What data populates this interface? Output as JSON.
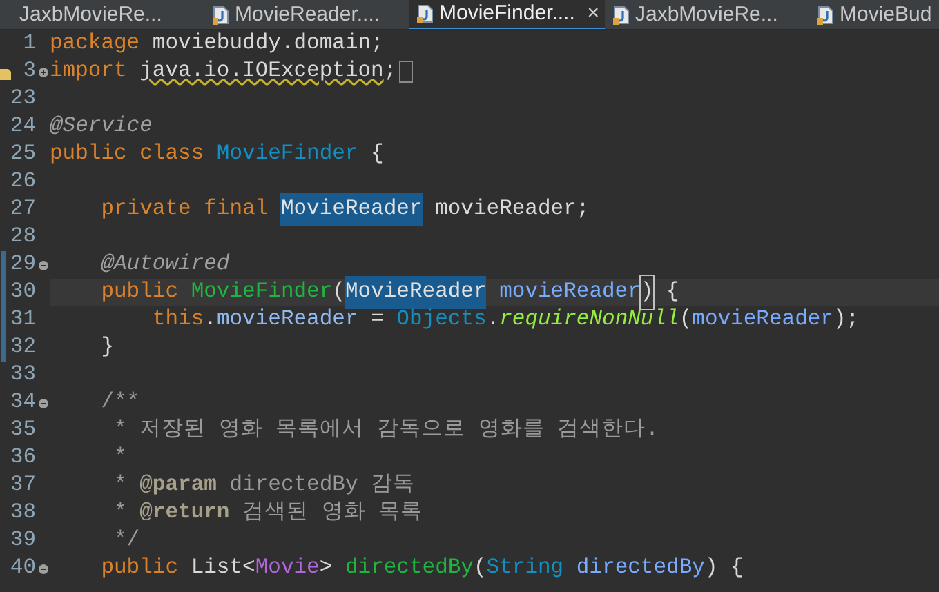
{
  "tabs": [
    {
      "label": "JaxbMovieRe...",
      "selected": false,
      "icon": false
    },
    {
      "label": "MovieReader....",
      "selected": false,
      "icon": true
    },
    {
      "label": "MovieFinder....",
      "selected": true,
      "icon": true,
      "close": "×"
    },
    {
      "label": "JaxbMovieRe...",
      "selected": false,
      "icon": true
    },
    {
      "label": "MovieBud",
      "selected": false,
      "icon": true
    }
  ],
  "lines": [
    {
      "number": "1",
      "current": false,
      "changed": false,
      "tokens": [
        {
          "kind": "keyword",
          "text": "package"
        },
        {
          "kind": "plain",
          "text": " moviebuddy.domain;"
        }
      ]
    },
    {
      "number": "3",
      "expanded": false,
      "warning": true,
      "current": false,
      "changed": false,
      "tokens": [
        {
          "kind": "keyword",
          "text": "import "
        },
        {
          "kind": "warned",
          "text": "java.io.IOException"
        },
        {
          "kind": "plain",
          "text": ";"
        }
      ]
    },
    {
      "number": "23",
      "current": false,
      "changed": false
    },
    {
      "number": "24",
      "current": false,
      "changed": false,
      "tokens": [
        {
          "kind": "annotation",
          "text": "@Service"
        }
      ]
    },
    {
      "number": "25",
      "current": false,
      "changed": false,
      "tokens": [
        {
          "kind": "keyword",
          "text": "public class "
        },
        {
          "kind": "type",
          "text": "MovieFinder"
        },
        {
          "kind": "plain",
          "text": " {"
        }
      ]
    },
    {
      "number": "26",
      "current": false,
      "changed": false
    },
    {
      "number": "27",
      "current": false,
      "changed": false,
      "tokens": [
        {
          "kind": "keyword",
          "text": "    private final "
        },
        {
          "kind": "occurrence",
          "text": "MovieReader"
        },
        {
          "kind": "plain",
          "text": " movieReader;"
        }
      ]
    },
    {
      "number": "28",
      "current": false,
      "changed": false
    },
    {
      "number": "29",
      "expanded": true,
      "current": false,
      "changed": true,
      "tokens": [
        {
          "kind": "annotation",
          "text": "    @Autowired"
        }
      ]
    },
    {
      "number": "30",
      "current": true,
      "changed": true,
      "tokens": [
        {
          "kind": "keyword",
          "text": "    public "
        },
        {
          "kind": "method",
          "text": "MovieFinder"
        },
        {
          "kind": "plain",
          "text": "("
        },
        {
          "kind": "occurrence",
          "text": "MovieReader"
        },
        {
          "kind": "param",
          "text": " movieReader"
        },
        {
          "kind": "bracket",
          "text": ")"
        },
        {
          "kind": "plain",
          "text": " {"
        }
      ]
    },
    {
      "number": "31",
      "current": false,
      "changed": true,
      "tokens": [
        {
          "kind": "keyword",
          "text": "        this"
        },
        {
          "kind": "plain",
          "text": "."
        },
        {
          "kind": "field",
          "text": "movieReader"
        },
        {
          "kind": "plain",
          "text": " = "
        },
        {
          "kind": "type",
          "text": "Objects"
        },
        {
          "kind": "plain",
          "text": "."
        },
        {
          "kind": "static",
          "text": "requireNonNull"
        },
        {
          "kind": "plain",
          "text": "("
        },
        {
          "kind": "param",
          "text": "movieReader"
        },
        {
          "kind": "plain",
          "text": ");"
        }
      ]
    },
    {
      "number": "32",
      "current": false,
      "changed": true,
      "tokens": [
        {
          "kind": "plain",
          "text": "    }"
        }
      ]
    },
    {
      "number": "33",
      "current": false,
      "changed": false
    },
    {
      "number": "34",
      "expanded": true,
      "current": false,
      "changed": false,
      "tokens": [
        {
          "kind": "comment",
          "text": "    /**"
        }
      ]
    },
    {
      "number": "35",
      "current": false,
      "changed": false,
      "tokens": [
        {
          "kind": "comment",
          "text": "     * 저장된 영화 목록에서 감독으로 영화를 검색한다."
        }
      ]
    },
    {
      "number": "36",
      "current": false,
      "changed": false,
      "tokens": [
        {
          "kind": "comment",
          "text": "     *"
        }
      ]
    },
    {
      "number": "37",
      "current": false,
      "changed": false,
      "tokens": [
        {
          "kind": "comment",
          "text": "     * "
        },
        {
          "kind": "tag",
          "text": "@param"
        },
        {
          "kind": "comment",
          "text": " directedBy 감독"
        }
      ]
    },
    {
      "number": "38",
      "current": false,
      "changed": false,
      "tokens": [
        {
          "kind": "comment",
          "text": "     * "
        },
        {
          "kind": "tag",
          "text": "@return"
        },
        {
          "kind": "comment",
          "text": " 검색된 영화 목록"
        }
      ]
    },
    {
      "number": "39",
      "current": false,
      "changed": false,
      "tokens": [
        {
          "kind": "comment",
          "text": "     */"
        }
      ]
    },
    {
      "number": "40",
      "expanded": true,
      "current": false,
      "changed": false,
      "tokens": [
        {
          "kind": "keyword",
          "text": "    public "
        },
        {
          "kind": "plain",
          "text": "List<"
        },
        {
          "kind": "typearg",
          "text": "Movie"
        },
        {
          "kind": "plain",
          "text": "> "
        },
        {
          "kind": "method",
          "text": "directedBy"
        },
        {
          "kind": "plain",
          "text": "("
        },
        {
          "kind": "type",
          "text": "String"
        },
        {
          "kind": "param",
          "text": " directedBy"
        },
        {
          "kind": "plain",
          "text": ") {"
        }
      ]
    }
  ]
}
